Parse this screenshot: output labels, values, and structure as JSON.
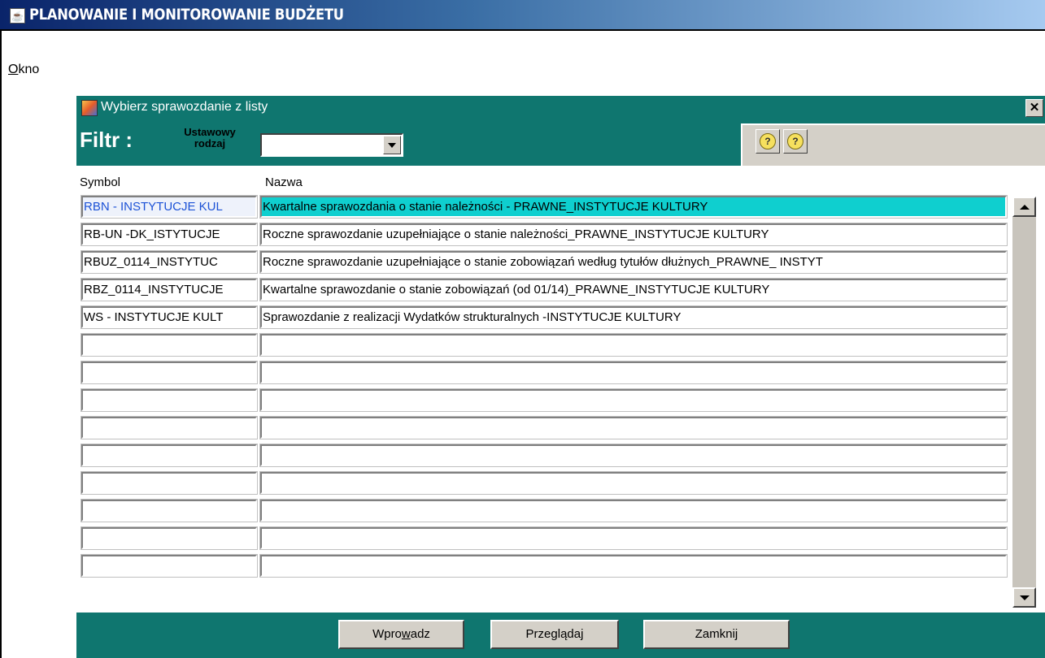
{
  "app": {
    "title": "PLANOWANIE I MONITOROWANIE BUDŻETU",
    "menu": {
      "okno_underlined": "O",
      "okno_rest": "kno"
    }
  },
  "dialog": {
    "title": "Wybierz sprawozdanie z listy",
    "close_label": "✕",
    "filter": {
      "label": "Filtr :",
      "caption_line1": "Ustawowy",
      "caption_line2": "rodzaj",
      "select_value": ""
    },
    "columns": {
      "symbol": "Symbol",
      "name": "Nazwa"
    },
    "rows": [
      {
        "symbol": "RBN - INSTYTUCJE KUL",
        "name": "Kwartalne sprawozdania o stanie należności - PRAWNE_INSTYTUCJE KULTURY",
        "selected": true
      },
      {
        "symbol": "RB-UN -DK_ISTYTUCJE",
        "name": "Roczne sprawozdanie uzupełniające o stanie należności_PRAWNE_INSTYTUCJE KULTURY"
      },
      {
        "symbol": "RBUZ_0114_INSTYTUC",
        "name": "Roczne sprawozdanie uzupełniające o stanie zobowiązań według tytułów dłużnych_PRAWNE_ INSTYT"
      },
      {
        "symbol": "RBZ_0114_INSTYTUCJE",
        "name": "Kwartalne sprawozdanie o stanie zobowiązań (od 01/14)_PRAWNE_INSTYTUCJE KULTURY"
      },
      {
        "symbol": "WS - INSTYTUCJE KULT",
        "name": "Sprawozdanie z realizacji Wydatków strukturalnych -INSTYTUCJE KULTURY"
      },
      {
        "symbol": "",
        "name": ""
      },
      {
        "symbol": "",
        "name": ""
      },
      {
        "symbol": "",
        "name": ""
      },
      {
        "symbol": "",
        "name": ""
      },
      {
        "symbol": "",
        "name": ""
      },
      {
        "symbol": "",
        "name": ""
      },
      {
        "symbol": "",
        "name": ""
      },
      {
        "symbol": "",
        "name": ""
      },
      {
        "symbol": "",
        "name": ""
      }
    ],
    "buttons": {
      "wprowadz_pre": "Wpro",
      "wprowadz_u": "w",
      "wprowadz_post": "adz",
      "przegladaj": "Przeglądaj",
      "zamknij": "Zamknij"
    }
  },
  "colors": {
    "dialog_teal": "#0f766f",
    "selected_row": "#0fcfcf",
    "window_chrome": "#d4d0c8"
  },
  "icons": [
    "java-app-icon",
    "dialog-icon",
    "close-icon",
    "dropdown-arrow-icon",
    "query-enter-icon",
    "query-execute-icon",
    "scroll-up-icon",
    "scroll-down-icon"
  ]
}
